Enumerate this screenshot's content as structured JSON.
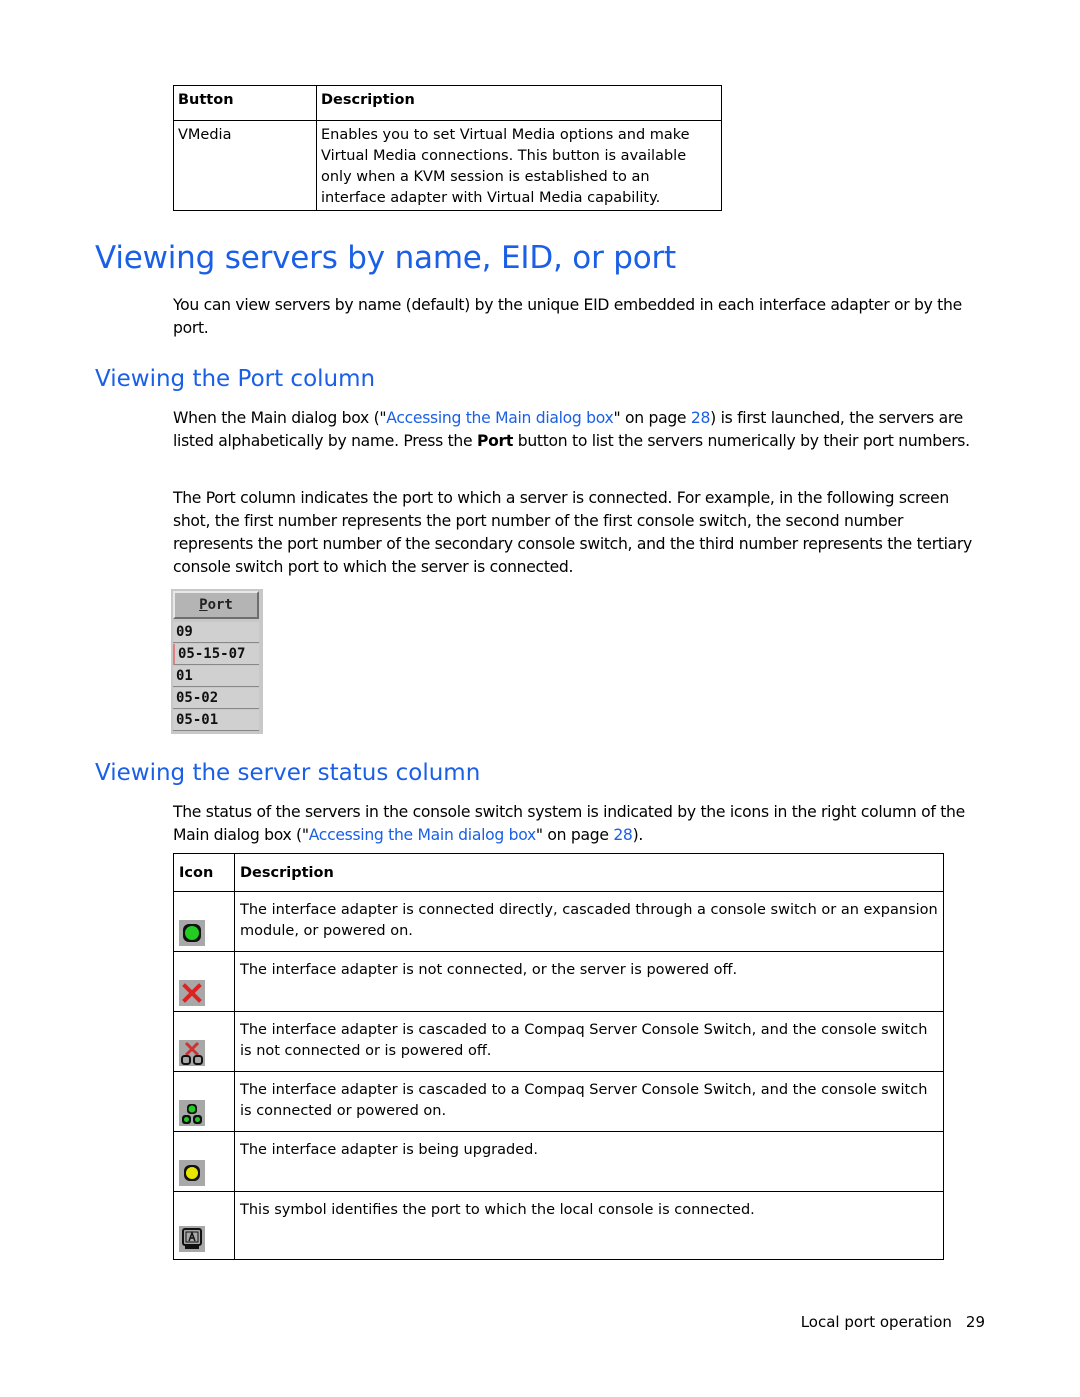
{
  "button_table": {
    "headers": [
      "Button",
      "Description"
    ],
    "rows": [
      {
        "button": "VMedia",
        "description": "Enables you to set Virtual Media options and make Virtual Media connections. This button is available only when a KVM session is established to an interface adapter with Virtual Media capability."
      }
    ]
  },
  "section": {
    "title": "Viewing servers by name, EID, or port",
    "intro": "You can view servers by name (default) by the unique EID embedded in each interface adapter or by the port."
  },
  "port_column": {
    "title": "Viewing the Port column",
    "para1_before": "When the Main dialog box (\"",
    "para1_link": "Accessing the Main dialog box",
    "para1_mid": "\" on page ",
    "para1_page": "28",
    "para1_after1": ") is first launched, the servers are listed alphabetically by name. Press the ",
    "para1_bold": "Port",
    "para1_after2": " button to list the servers numerically by their port numbers.",
    "para2": "The Port column indicates the port to which a server is connected. For example, in the following screen shot, the first number represents the port number of the first console switch, the second number represents the port number of the secondary console switch, and the third number represents the tertiary console switch port to which the server is connected.",
    "widget": {
      "button_label_underlined": "P",
      "button_label_rest": "ort",
      "rows": [
        "09",
        "05-15-07",
        "01",
        "05-02",
        "05-01"
      ]
    }
  },
  "status_column": {
    "title": "Viewing the server status column",
    "para_before": "The status of the servers in the console switch system is indicated by the icons in the right column of the Main dialog box (\"",
    "para_link": "Accessing the Main dialog box",
    "para_mid": "\" on page ",
    "para_page": "28",
    "para_after": ").",
    "table": {
      "headers": [
        "Icon",
        "Description"
      ],
      "rows": [
        {
          "icon": "green-circle-icon",
          "description": "The interface adapter is connected directly, cascaded through a console switch or an expansion module, or powered on."
        },
        {
          "icon": "red-x-icon",
          "description": "The interface adapter is not connected, or the server is powered off."
        },
        {
          "icon": "cascade-off-icon",
          "description": "The interface adapter is cascaded to a Compaq Server Console Switch, and the console switch is not connected or is powered off."
        },
        {
          "icon": "cascade-on-icon",
          "description": "The interface adapter is cascaded to a Compaq Server Console Switch, and the console switch is connected or powered on."
        },
        {
          "icon": "yellow-circle-icon",
          "description": "The interface adapter is being upgraded."
        },
        {
          "icon": "local-console-icon",
          "description": "This symbol identifies the port to which the local console is connected."
        }
      ]
    }
  },
  "footer": {
    "section": "Local port operation",
    "page": "29"
  },
  "colors": {
    "heading": "#1a5fe6",
    "link": "#1a5fe6",
    "status_green": "#22cc22",
    "status_red": "#dd2222",
    "status_yellow": "#e6e600"
  }
}
